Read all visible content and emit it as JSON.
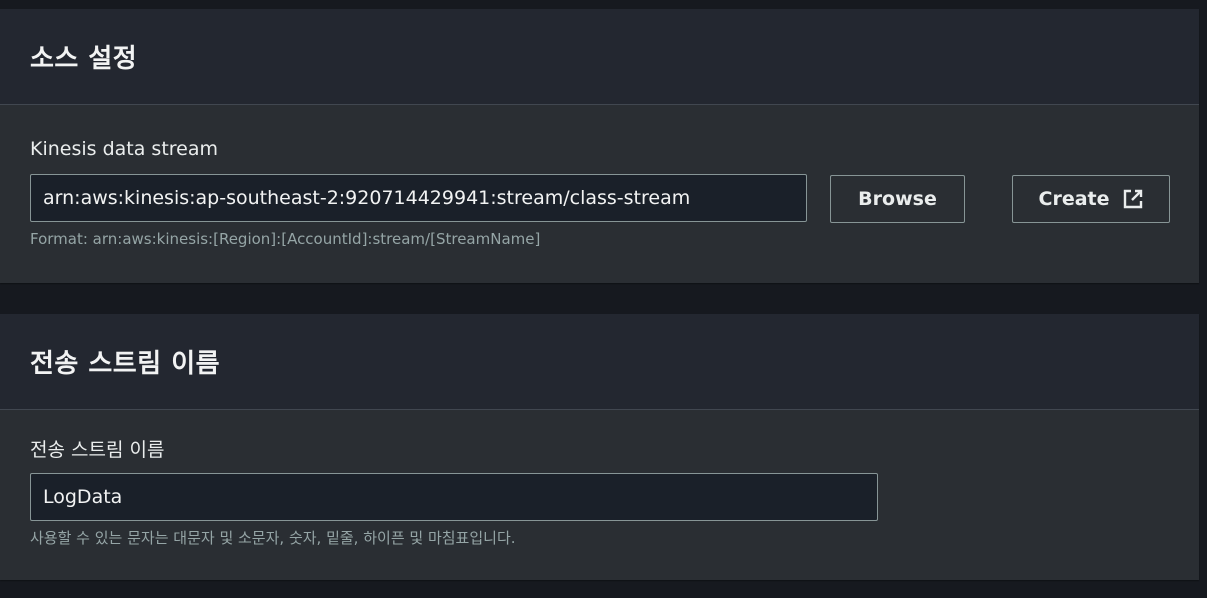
{
  "source_section": {
    "title": "소스 설정",
    "stream_label": "Kinesis data stream",
    "stream_value": "arn:aws:kinesis:ap-southeast-2:920714429941:stream/class-stream",
    "format_hint": "Format: arn:aws:kinesis:[Region]:[AccountId]:stream/[StreamName]",
    "browse_label": "Browse",
    "create_label": "Create",
    "create_icon": "external-link-icon"
  },
  "delivery_section": {
    "title": "전송 스트림 이름",
    "name_label": "전송 스트림 이름",
    "name_value": "LogData",
    "name_hint": "사용할 수 있는 문자는 대문자 및 소문자, 숫자, 밑줄, 하이픈 및 마침표입니다."
  },
  "colors": {
    "page_background": "#16191f",
    "panel_background": "#2a2e33",
    "header_background": "#232730",
    "input_background": "#1a2029",
    "border": "#879596"
  }
}
